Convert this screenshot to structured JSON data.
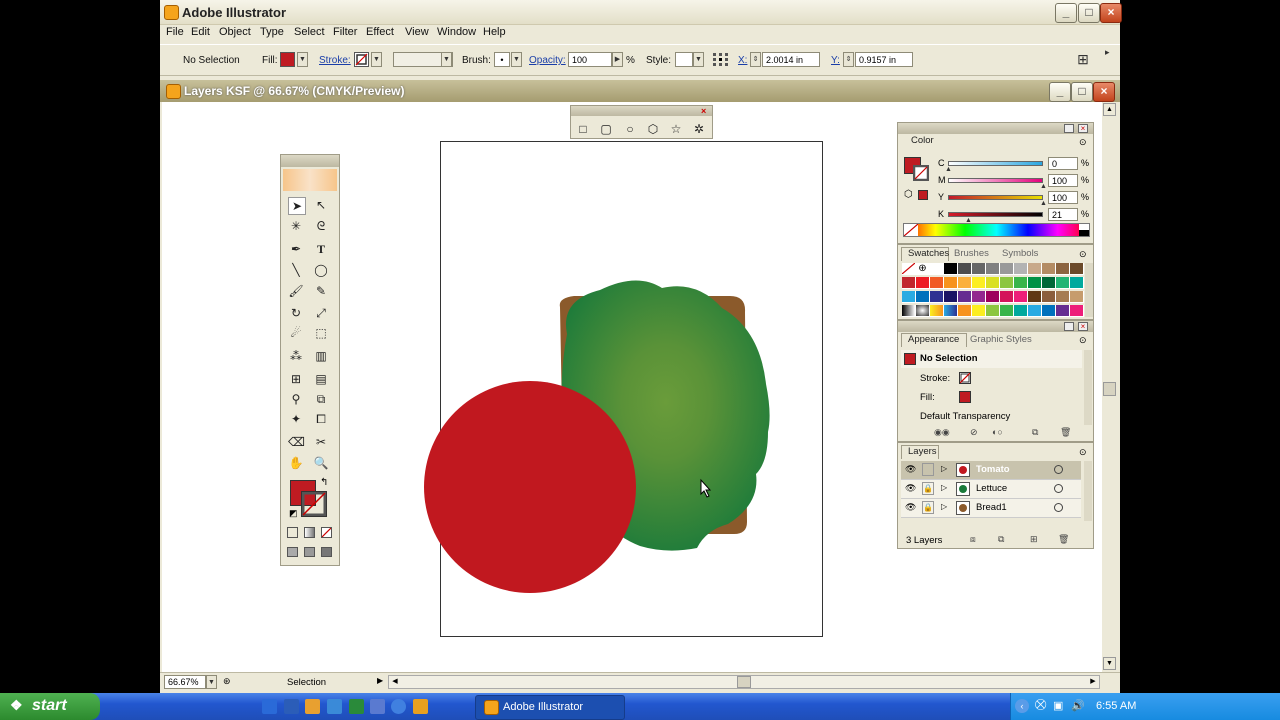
{
  "app": {
    "title": "Adobe Illustrator"
  },
  "menu": [
    "File",
    "Edit",
    "Object",
    "Type",
    "Select",
    "Filter",
    "Effect",
    "View",
    "Window",
    "Help"
  ],
  "control_bar": {
    "selection": "No Selection",
    "fill_label": "Fill:",
    "stroke_label": "Stroke:",
    "brush_label": "Brush:",
    "brush_value": "•",
    "opacity_label": "Opacity:",
    "opacity_value": "100",
    "opacity_unit": "%",
    "style_label": "Style:",
    "x_label": "X:",
    "x_value": "2.0014 in",
    "y_label": "Y:",
    "y_value": "0.9157 in"
  },
  "document": {
    "title": "Layers KSF @ 66.67% (CMYK/Preview)"
  },
  "status": {
    "zoom": "66.67%",
    "tool": "Selection"
  },
  "color_panel": {
    "tab": "Color",
    "channels": [
      {
        "label": "C",
        "value": "0",
        "unit": "%",
        "level": 0.0,
        "gradient": "linear-gradient(90deg,#ffffff,#2aa6e0)"
      },
      {
        "label": "M",
        "value": "100",
        "unit": "%",
        "level": 1.0,
        "gradient": "linear-gradient(90deg,#ffffff,#e4007c)"
      },
      {
        "label": "Y",
        "value": "100",
        "unit": "%",
        "level": 1.0,
        "gradient": "linear-gradient(90deg,#c2182b,#e8e000)"
      },
      {
        "label": "K",
        "value": "21",
        "unit": "%",
        "level": 0.21,
        "gradient": "linear-gradient(90deg,#d61c2a,#000000)"
      }
    ]
  },
  "swatch_tabs": [
    "Swatches",
    "Brushes",
    "Symbols"
  ],
  "swatches": [
    "none",
    "reg",
    "#ffffff",
    "#000000",
    "#4d4d4d",
    "#666666",
    "#808080",
    "#999999",
    "#b3b3b3",
    "#c8a98a",
    "#b48c64",
    "#8c6440",
    "#6b4a2a",
    "#c1272d",
    "#ed1c24",
    "#f15a24",
    "#f7931e",
    "#fbb03b",
    "#fcee21",
    "#d9e021",
    "#8cc63f",
    "#39b54a",
    "#009245",
    "#006837",
    "#22b573",
    "#00a99d",
    "#29abe2",
    "#0071bc",
    "#2e3192",
    "#1b1464",
    "#662d91",
    "#93278f",
    "#9e005d",
    "#d4145a",
    "#ed1e79",
    "#603813",
    "#8b5e3c",
    "#a67c52",
    "#c69c6d",
    "grad1",
    "grad2",
    "grad3",
    "grad4",
    "#f7931e",
    "#fcee21",
    "#8cc63f",
    "#39b54a",
    "#00a99d",
    "#29abe2",
    "#0071bc",
    "#662d91",
    "#ed1e79"
  ],
  "appearance_tabs": [
    "Appearance",
    "Graphic Styles"
  ],
  "appearance": {
    "selection": "No Selection",
    "stroke_label": "Stroke:",
    "fill_label": "Fill:",
    "transparency": "Default Transparency"
  },
  "layers_panel": {
    "tab": "Layers",
    "layers": [
      {
        "name": "Tomato",
        "color": "#c1181f",
        "selected": true
      },
      {
        "name": "Lettuce",
        "color": "#1a7a3a",
        "selected": false
      },
      {
        "name": "Bread1",
        "color": "#8b5a2b",
        "selected": false
      }
    ],
    "count": "3 Layers"
  },
  "colors": {
    "fill": "#bf1b22",
    "tomato": "#c1181f",
    "lettuce_dark": "#1a7a3a",
    "lettuce_light": "#6a9c3a",
    "bread": "#8b5a2b",
    "accent_blue": "#1a3ea8"
  },
  "taskbar": {
    "start": "start",
    "task": "Adobe Illustrator",
    "clock": "6:55 AM"
  }
}
